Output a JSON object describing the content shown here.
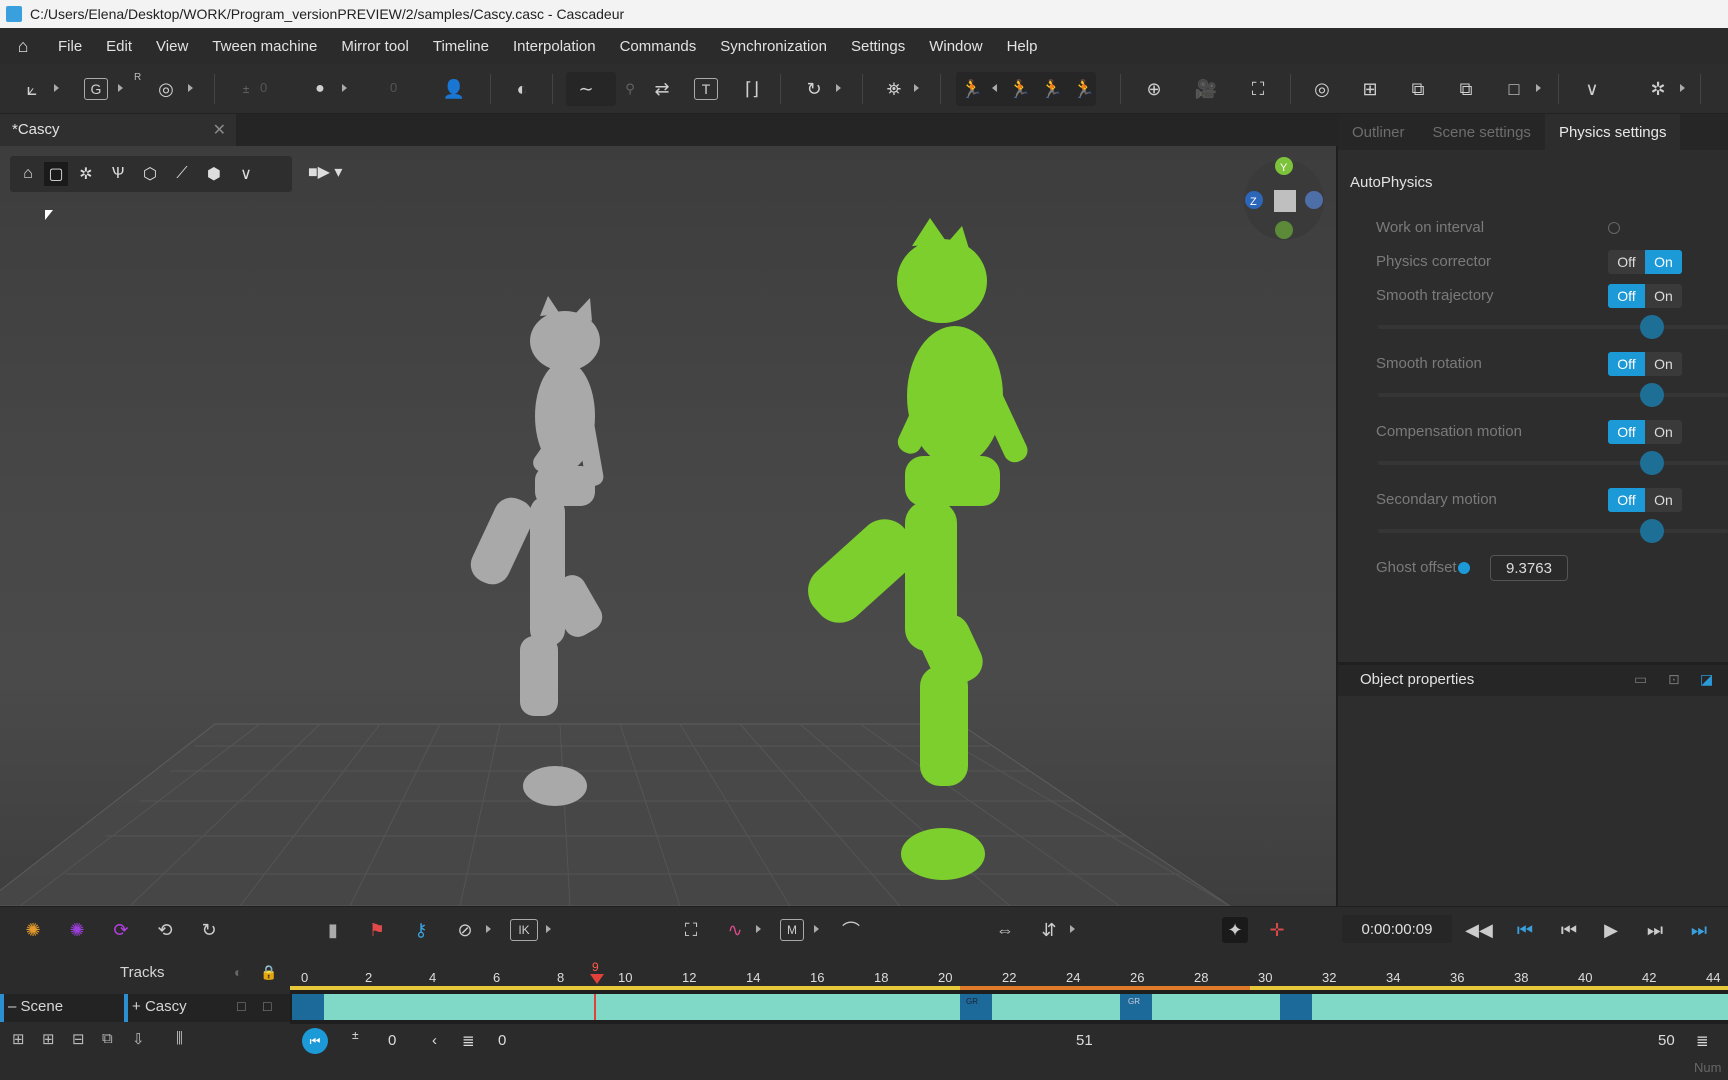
{
  "window": {
    "title": "C:/Users/Elena/Desktop/WORK/Program_versionPREVIEW/2/samples/Cascy.casc - Cascadeur"
  },
  "menu": {
    "home_icon": "home-icon",
    "items": [
      "File",
      "Edit",
      "View",
      "Tween machine",
      "Mirror tool",
      "Timeline",
      "Interpolation",
      "Commands",
      "Synchronization",
      "Settings",
      "Window",
      "Help"
    ]
  },
  "toolbar": {
    "g_label": "G",
    "r_label": "R",
    "t_label": "T",
    "num1": "0",
    "num2": "0"
  },
  "document_tab": {
    "label": "*Cascy",
    "close": "✕"
  },
  "gizmo": {
    "y": "Y",
    "z": "Z"
  },
  "right_panel": {
    "tabs": [
      "Outliner",
      "Scene settings",
      "Physics settings"
    ],
    "section": "AutoPhysics",
    "work_on_interval": "Work on interval",
    "physics_corrector": "Physics corrector",
    "smooth_trajectory": "Smooth trajectory",
    "smooth_rotation": "Smooth rotation",
    "compensation_motion": "Compensation motion",
    "secondary_motion": "Secondary motion",
    "ghost_offset": "Ghost offset",
    "ghost_offset_value": "9.3763",
    "off": "Off",
    "on": "On",
    "object_properties": "Object properties"
  },
  "timeline": {
    "ik_label": "IK",
    "m_label": "M",
    "timecode": "0:00:00:09",
    "tracks_label": "Tracks",
    "scene_label": "Scene",
    "cascy_label": "Cascy",
    "ruler_ticks": [
      "0",
      "2",
      "4",
      "6",
      "8",
      "10",
      "12",
      "14",
      "16",
      "18",
      "20",
      "22",
      "24",
      "26",
      "28",
      "30",
      "32",
      "34",
      "36",
      "38",
      "40",
      "42",
      "44"
    ],
    "current_frame": "9",
    "gr1": "GR",
    "gr2": "GR",
    "bottom_start": "0",
    "bottom_prev": "0",
    "bottom_mid": "51",
    "bottom_end": "50",
    "num_label": "Num"
  }
}
